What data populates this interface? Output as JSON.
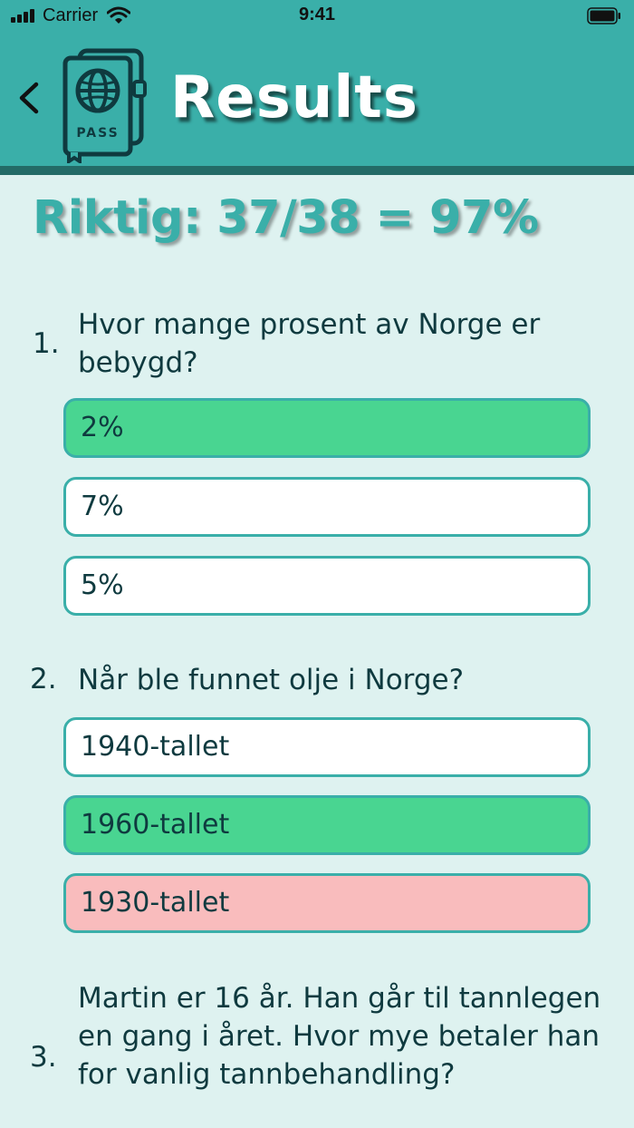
{
  "status_bar": {
    "carrier": "Carrier",
    "time": "9:41"
  },
  "header": {
    "title": "Results",
    "passport_label": "PASS"
  },
  "score": {
    "text": "Riktig: 37/38 = 97%"
  },
  "colors": {
    "header": "#3aafa9",
    "header_border": "#236b67",
    "background": "#def2f0",
    "correct": "#49d591",
    "wrong": "#f9bcbd",
    "text": "#0f3a3f"
  },
  "questions": [
    {
      "number": "1.",
      "text": "Hvor mange prosent av Norge er bebygd?",
      "answers": [
        {
          "text": "2%",
          "state": "correct"
        },
        {
          "text": "7%",
          "state": "neutral"
        },
        {
          "text": "5%",
          "state": "neutral"
        }
      ]
    },
    {
      "number": "2.",
      "text": "Når ble funnet olje i Norge?",
      "answers": [
        {
          "text": "1940-tallet",
          "state": "neutral"
        },
        {
          "text": "1960-tallet",
          "state": "correct"
        },
        {
          "text": "1930-tallet",
          "state": "wrong"
        }
      ]
    },
    {
      "number": "3.",
      "text": "Martin er 16 år. Han går til tannlegen en gang i året. Hvor mye betaler han for vanlig tannbehandling?",
      "answers": []
    }
  ]
}
